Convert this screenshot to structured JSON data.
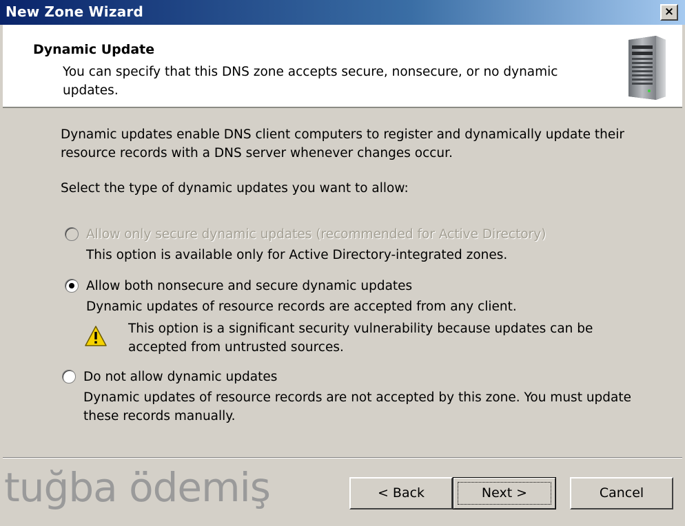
{
  "window": {
    "title": "New Zone Wizard",
    "close_label": "×"
  },
  "header": {
    "title": "Dynamic Update",
    "subtitle": "You can specify that this DNS zone accepts secure, nonsecure, or no dynamic updates.",
    "icon": "server-icon"
  },
  "content": {
    "intro": "Dynamic updates enable DNS client computers to register and dynamically update their resource records with a DNS server whenever changes occur.",
    "prompt": "Select the type of dynamic updates you want to allow:"
  },
  "options": [
    {
      "label": "Allow only secure dynamic updates (recommended for Active Directory)",
      "description": "This option is available only for Active Directory-integrated zones.",
      "selected": false,
      "enabled": false
    },
    {
      "label": "Allow both nonsecure and secure dynamic updates",
      "description": "Dynamic updates of resource records are accepted from any client.",
      "selected": true,
      "enabled": true,
      "warning": "This option is a significant security vulnerability because updates can be accepted from untrusted sources.",
      "warning_icon": "warning-icon"
    },
    {
      "label": "Do not allow dynamic updates",
      "description": "Dynamic updates of resource records are not accepted by this zone. You must update these records manually.",
      "selected": false,
      "enabled": true
    }
  ],
  "watermark": "tuğba ödemiş",
  "buttons": {
    "back": "< Back",
    "next": "Next >",
    "cancel": "Cancel"
  },
  "colors": {
    "titlebar_start": "#0a246a",
    "titlebar_end": "#a6caf0",
    "dialog_bg": "#d4d0c8",
    "warning_yellow": "#f5d200"
  }
}
